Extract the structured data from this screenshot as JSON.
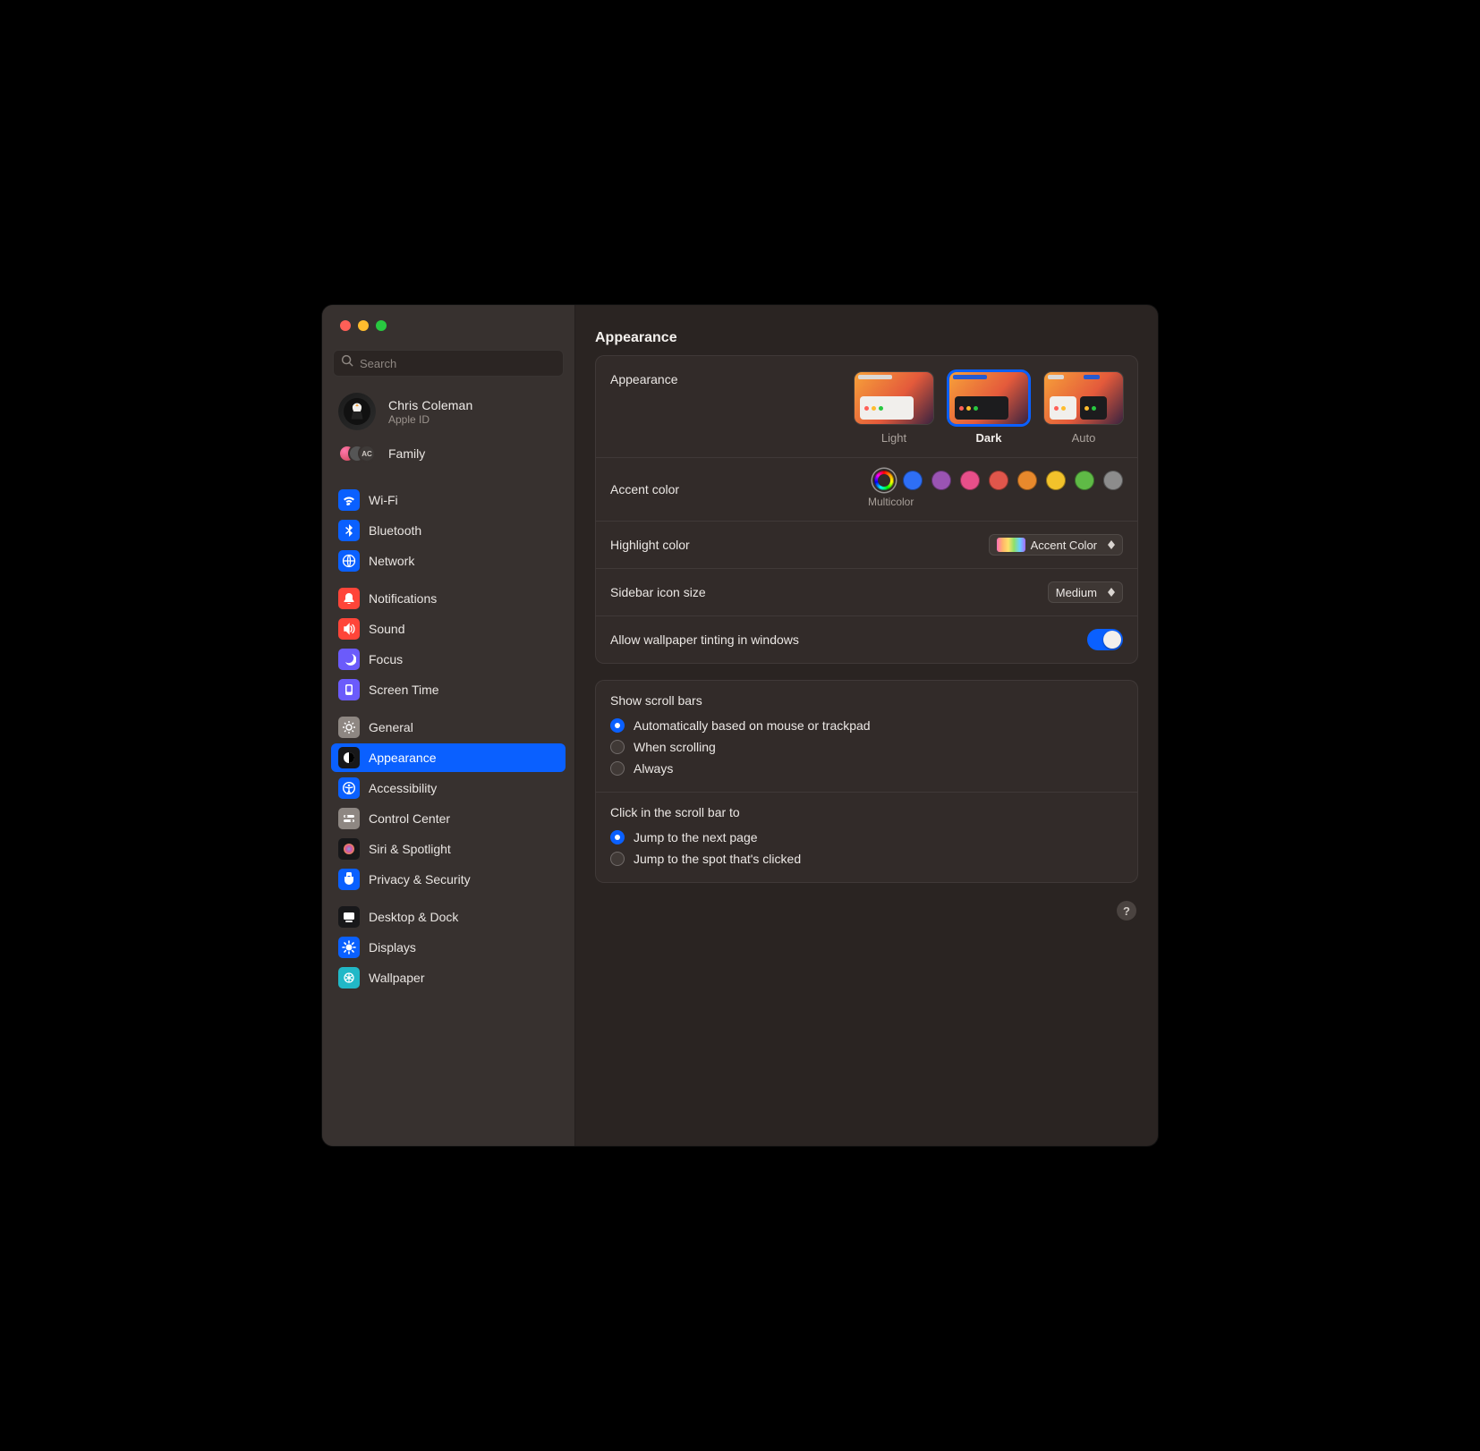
{
  "search": {
    "placeholder": "Search"
  },
  "account": {
    "name": "Chris Coleman",
    "sub": "Apple ID"
  },
  "family": {
    "label": "Family",
    "badge": "AC"
  },
  "page_title": "Appearance",
  "sidebar": {
    "groups": [
      [
        {
          "label": "Wi-Fi",
          "bg": "#0a60ff"
        },
        {
          "label": "Bluetooth",
          "bg": "#0a60ff"
        },
        {
          "label": "Network",
          "bg": "#0a60ff"
        }
      ],
      [
        {
          "label": "Notifications",
          "bg": "#ff4539"
        },
        {
          "label": "Sound",
          "bg": "#ff4539"
        },
        {
          "label": "Focus",
          "bg": "#6b5bfb"
        },
        {
          "label": "Screen Time",
          "bg": "#6b5bfb"
        }
      ],
      [
        {
          "label": "General",
          "bg": "#8e8782"
        },
        {
          "label": "Appearance",
          "bg": "#18181a",
          "selected": true
        },
        {
          "label": "Accessibility",
          "bg": "#0a60ff"
        },
        {
          "label": "Control Center",
          "bg": "#8e8782"
        },
        {
          "label": "Siri & Spotlight",
          "bg": "#18181a"
        },
        {
          "label": "Privacy & Security",
          "bg": "#0a60ff"
        }
      ],
      [
        {
          "label": "Desktop & Dock",
          "bg": "#18181a"
        },
        {
          "label": "Displays",
          "bg": "#0a60ff"
        },
        {
          "label": "Wallpaper",
          "bg": "#21b8c7"
        }
      ]
    ]
  },
  "appearance": {
    "label": "Appearance",
    "options": [
      {
        "label": "Light",
        "selected": false
      },
      {
        "label": "Dark",
        "selected": true
      },
      {
        "label": "Auto",
        "selected": false
      }
    ]
  },
  "accent": {
    "label": "Accent color",
    "caption": "Multicolor",
    "colors": [
      {
        "name": "multicolor",
        "hex": "multi",
        "selected": true
      },
      {
        "name": "blue",
        "hex": "#2e6ff6"
      },
      {
        "name": "purple",
        "hex": "#9a54b3"
      },
      {
        "name": "pink",
        "hex": "#e84f8a"
      },
      {
        "name": "red",
        "hex": "#e0564b"
      },
      {
        "name": "orange",
        "hex": "#e8892c"
      },
      {
        "name": "yellow",
        "hex": "#f2c22b"
      },
      {
        "name": "green",
        "hex": "#5fba46"
      },
      {
        "name": "graphite",
        "hex": "#8c8c8c"
      }
    ]
  },
  "highlight": {
    "label": "Highlight color",
    "value": "Accent Color"
  },
  "sidebar_icon": {
    "label": "Sidebar icon size",
    "value": "Medium"
  },
  "tint": {
    "label": "Allow wallpaper tinting in windows",
    "on": true
  },
  "scroll_show": {
    "title": "Show scroll bars",
    "opts": [
      {
        "label": "Automatically based on mouse or trackpad",
        "on": true
      },
      {
        "label": "When scrolling",
        "on": false
      },
      {
        "label": "Always",
        "on": false
      }
    ]
  },
  "scroll_click": {
    "title": "Click in the scroll bar to",
    "opts": [
      {
        "label": "Jump to the next page",
        "on": true
      },
      {
        "label": "Jump to the spot that's clicked",
        "on": false
      }
    ]
  },
  "help": "?"
}
